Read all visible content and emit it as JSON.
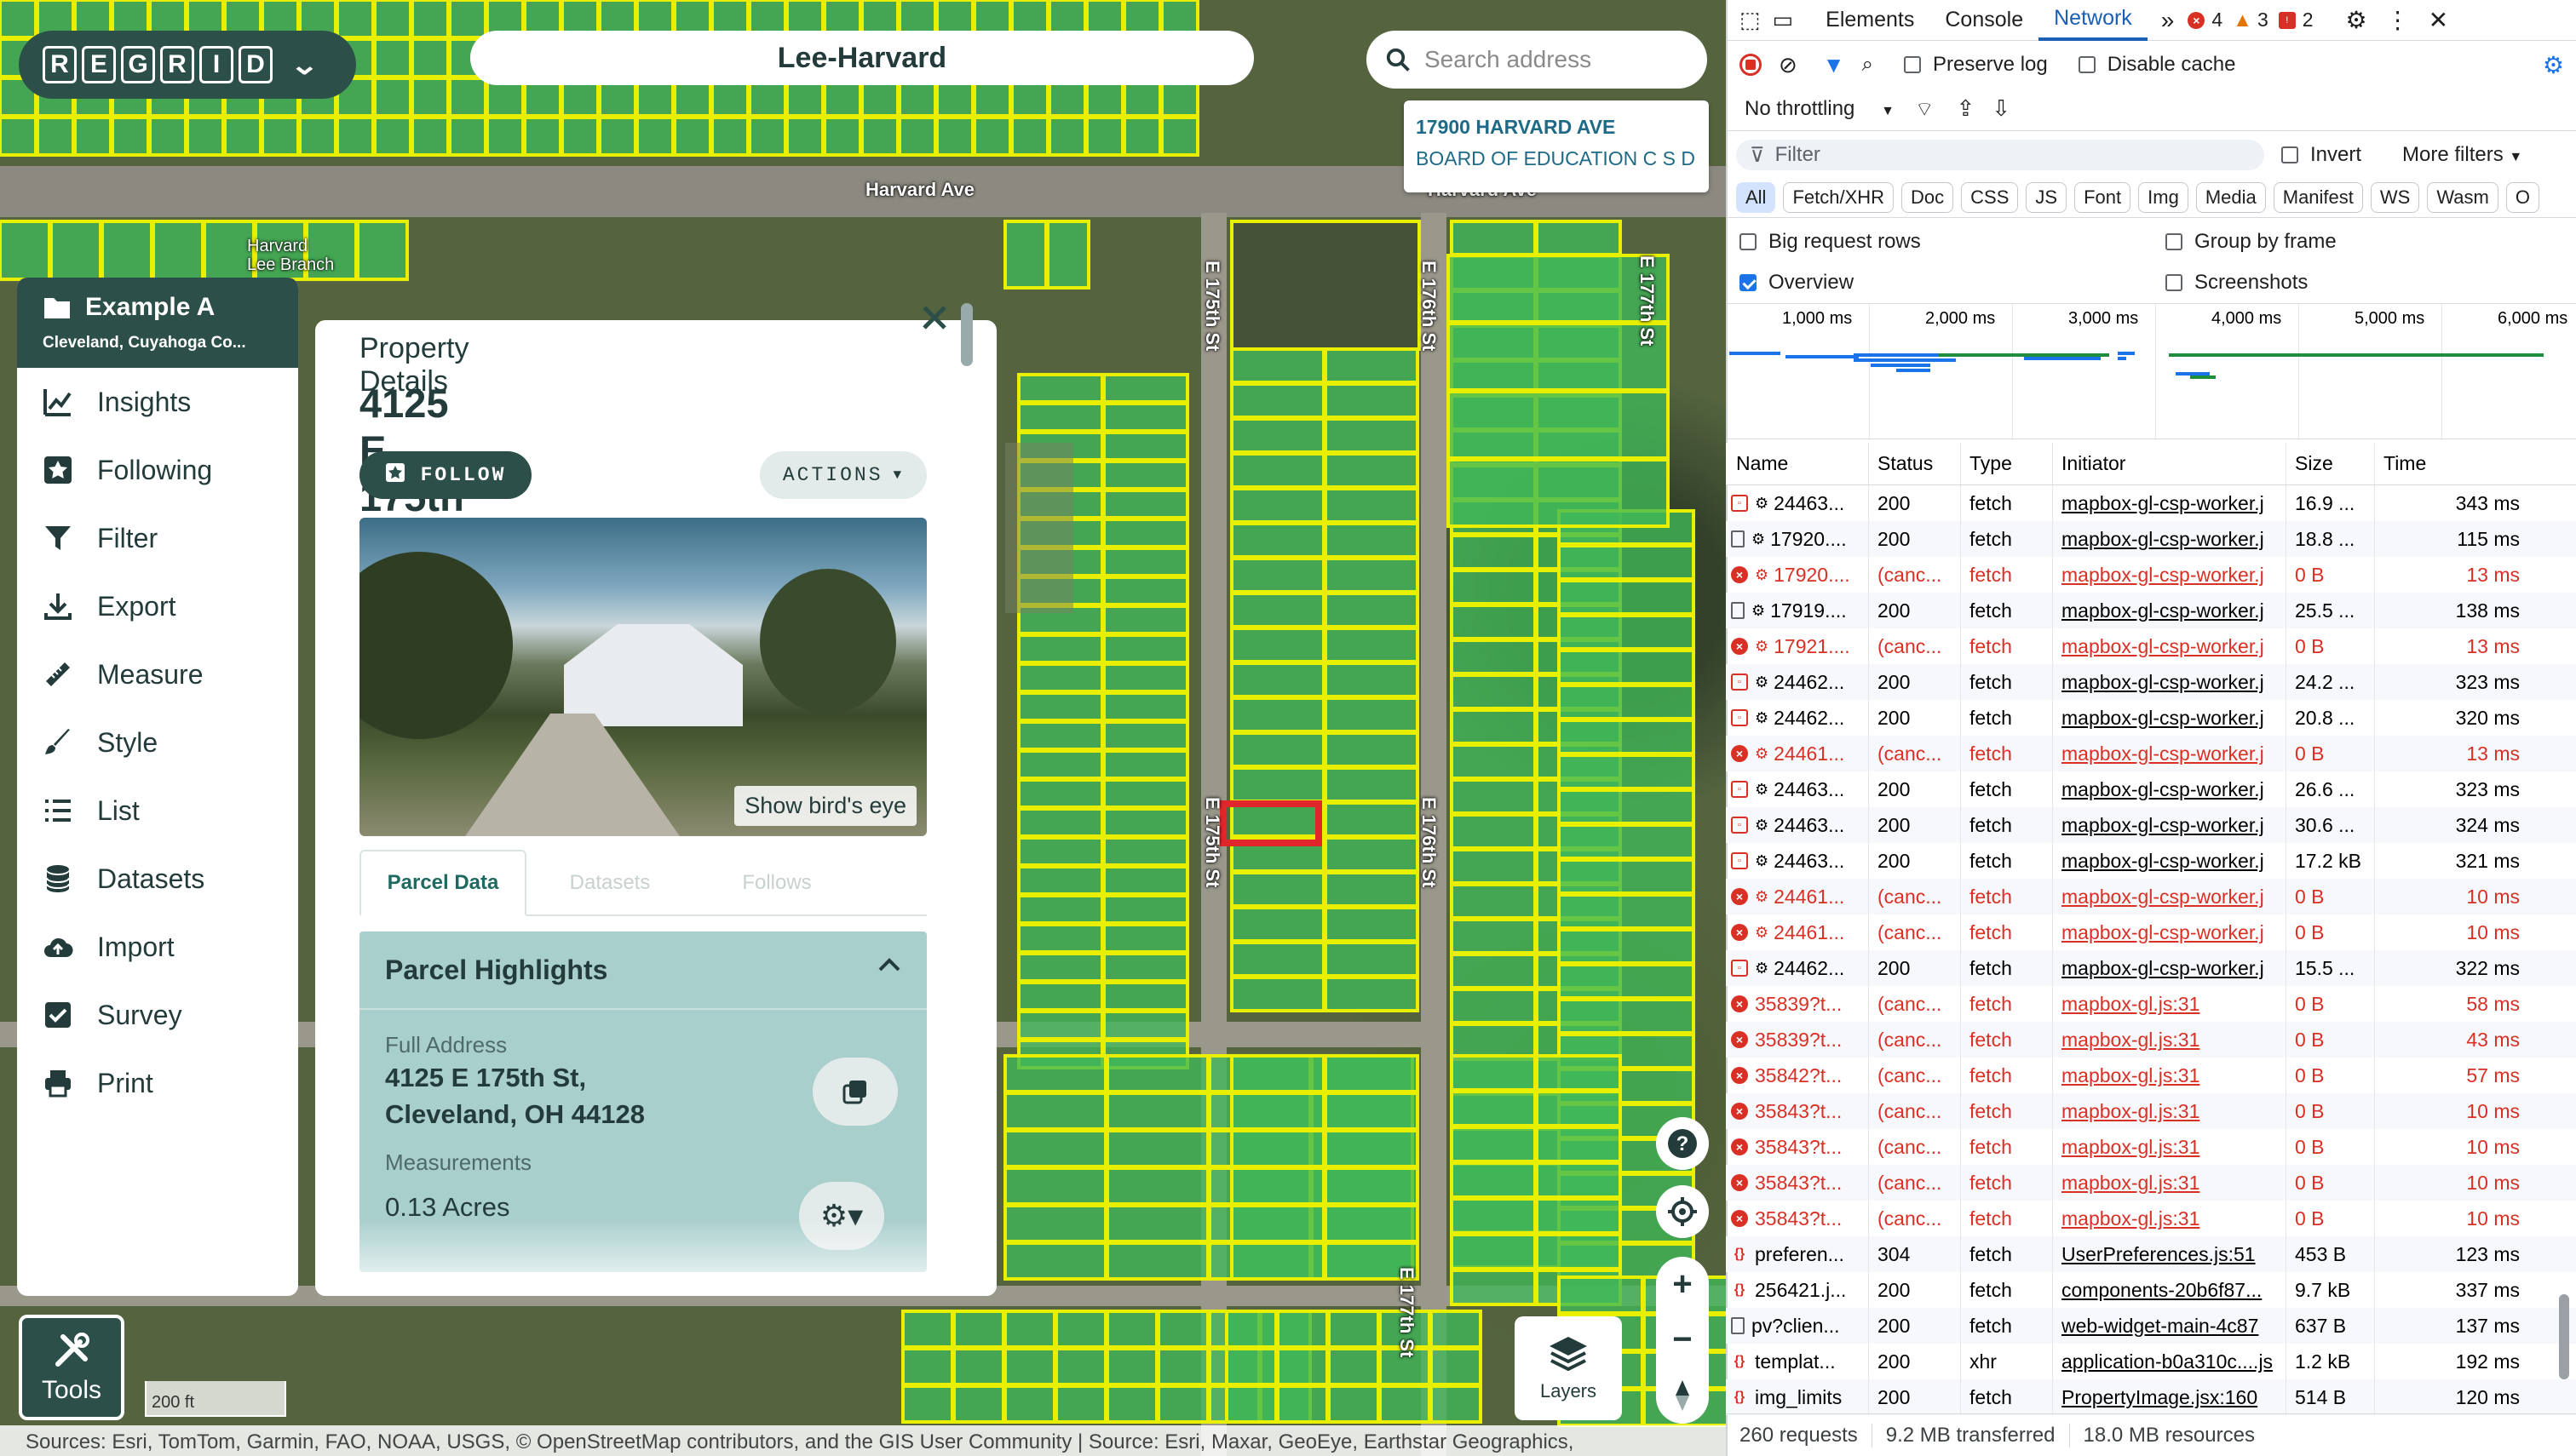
{
  "map": {
    "title": "Lee-Harvard",
    "search_placeholder": "Search address",
    "hover_card": {
      "address": "17900 HARVARD AVE",
      "owner": "BOARD OF EDUCATION C S D"
    },
    "road_labels": [
      "Harvard Ave",
      "Harvard Ave",
      "Harvard\nLee Branch",
      "E 175th St",
      "E 176th St",
      "E 177th St",
      "E 175th St",
      "E 176th St",
      "E 177th St"
    ],
    "scale": "200 ft",
    "attribution": "Sources: Esri, TomTom, Garmin, FAO, NOAA, USGS, © OpenStreetMap contributors, and the GIS User Community | Source: Esri, Maxar, GeoEye, Earthstar Geographics,",
    "layers_label": "Layers",
    "tools_label": "Tools",
    "parcel_color": "#e8f000",
    "selected_color": "#e0262a"
  },
  "logo": {
    "letters": [
      "R",
      "E",
      "G",
      "R",
      "I",
      "D"
    ]
  },
  "sidebar": {
    "project_name": "Example A",
    "project_location": "Cleveland, Cuyahoga Co...",
    "items": [
      {
        "label": "Insights",
        "icon": "chart-icon"
      },
      {
        "label": "Following",
        "icon": "star-icon"
      },
      {
        "label": "Filter",
        "icon": "funnel-icon"
      },
      {
        "label": "Export",
        "icon": "download-icon"
      },
      {
        "label": "Measure",
        "icon": "ruler-icon"
      },
      {
        "label": "Style",
        "icon": "brush-icon"
      },
      {
        "label": "List",
        "icon": "list-icon"
      },
      {
        "label": "Datasets",
        "icon": "database-icon"
      },
      {
        "label": "Import",
        "icon": "cloud-upload-icon"
      },
      {
        "label": "Survey",
        "icon": "checkbox-icon"
      },
      {
        "label": "Print",
        "icon": "printer-icon"
      }
    ]
  },
  "property": {
    "heading": "Property Details",
    "address": "4125 E 175th St",
    "follow_label": "FOLLOW",
    "actions_label": "ACTIONS",
    "birds_eye_label": "Show bird's eye",
    "tabs": [
      "Parcel Data",
      "Datasets",
      "Follows"
    ],
    "highlights_title": "Parcel Highlights",
    "full_address_label": "Full Address",
    "full_address_line1": "4125 E 175th St,",
    "full_address_line2": "Cleveland, OH 44128",
    "measurements_label": "Measurements",
    "measurements_value": "0.13 Acres"
  },
  "devtools": {
    "tabs": [
      "Elements",
      "Console",
      "Network"
    ],
    "active_tab": "Network",
    "errors": "4",
    "warnings": "3",
    "issues": "2",
    "preserve_log": "Preserve log",
    "disable_cache": "Disable cache",
    "throttling": "No throttling",
    "filter_placeholder": "Filter",
    "invert": "Invert",
    "more_filters": "More filters",
    "chips": [
      "All",
      "Fetch/XHR",
      "Doc",
      "CSS",
      "JS",
      "Font",
      "Img",
      "Media",
      "Manifest",
      "WS",
      "Wasm",
      "O"
    ],
    "options": [
      "Big request rows",
      "Group by frame",
      "Overview",
      "Screenshots"
    ],
    "overview_ticks": [
      "1,000 ms",
      "2,000 ms",
      "3,000 ms",
      "4,000 ms",
      "5,000 ms",
      "6,000 ms"
    ],
    "columns": [
      "Name",
      "Status",
      "Type",
      "Initiator",
      "Size",
      "Time"
    ],
    "rows": [
      {
        "icon": "fx",
        "name": "24463...",
        "status": "200",
        "type": "fetch",
        "initiator": "mapbox-gl-csp-worker.j",
        "size": "16.9 ...",
        "time": "343 ms",
        "err": false,
        "gear": true
      },
      {
        "icon": "doc",
        "name": "17920....",
        "status": "200",
        "type": "fetch",
        "initiator": "mapbox-gl-csp-worker.j",
        "size": "18.8 ...",
        "time": "115 ms",
        "err": false,
        "gear": true
      },
      {
        "icon": "err",
        "name": "17920....",
        "status": "(canc...",
        "type": "fetch",
        "initiator": "mapbox-gl-csp-worker.j",
        "size": "0 B",
        "time": "13 ms",
        "err": true,
        "gear": true
      },
      {
        "icon": "doc",
        "name": "17919....",
        "status": "200",
        "type": "fetch",
        "initiator": "mapbox-gl-csp-worker.j",
        "size": "25.5 ...",
        "time": "138 ms",
        "err": false,
        "gear": true
      },
      {
        "icon": "err",
        "name": "17921....",
        "status": "(canc...",
        "type": "fetch",
        "initiator": "mapbox-gl-csp-worker.j",
        "size": "0 B",
        "time": "13 ms",
        "err": true,
        "gear": true
      },
      {
        "icon": "fx",
        "name": "24462...",
        "status": "200",
        "type": "fetch",
        "initiator": "mapbox-gl-csp-worker.j",
        "size": "24.2 ...",
        "time": "323 ms",
        "err": false,
        "gear": true
      },
      {
        "icon": "fx",
        "name": "24462...",
        "status": "200",
        "type": "fetch",
        "initiator": "mapbox-gl-csp-worker.j",
        "size": "20.8 ...",
        "time": "320 ms",
        "err": false,
        "gear": true
      },
      {
        "icon": "err",
        "name": "24461...",
        "status": "(canc...",
        "type": "fetch",
        "initiator": "mapbox-gl-csp-worker.j",
        "size": "0 B",
        "time": "13 ms",
        "err": true,
        "gear": true
      },
      {
        "icon": "fx",
        "name": "24463...",
        "status": "200",
        "type": "fetch",
        "initiator": "mapbox-gl-csp-worker.j",
        "size": "26.6 ...",
        "time": "323 ms",
        "err": false,
        "gear": true
      },
      {
        "icon": "fx",
        "name": "24463...",
        "status": "200",
        "type": "fetch",
        "initiator": "mapbox-gl-csp-worker.j",
        "size": "30.6 ...",
        "time": "324 ms",
        "err": false,
        "gear": true
      },
      {
        "icon": "fx",
        "name": "24463...",
        "status": "200",
        "type": "fetch",
        "initiator": "mapbox-gl-csp-worker.j",
        "size": "17.2 kB",
        "time": "321 ms",
        "err": false,
        "gear": true
      },
      {
        "icon": "err",
        "name": "24461...",
        "status": "(canc...",
        "type": "fetch",
        "initiator": "mapbox-gl-csp-worker.j",
        "size": "0 B",
        "time": "10 ms",
        "err": true,
        "gear": true
      },
      {
        "icon": "err",
        "name": "24461...",
        "status": "(canc...",
        "type": "fetch",
        "initiator": "mapbox-gl-csp-worker.j",
        "size": "0 B",
        "time": "10 ms",
        "err": true,
        "gear": true
      },
      {
        "icon": "fx",
        "name": "24462...",
        "status": "200",
        "type": "fetch",
        "initiator": "mapbox-gl-csp-worker.j",
        "size": "15.5 ...",
        "time": "322 ms",
        "err": false,
        "gear": true
      },
      {
        "icon": "err",
        "name": "35839?t...",
        "status": "(canc...",
        "type": "fetch",
        "initiator": "mapbox-gl.js:31",
        "size": "0 B",
        "time": "58 ms",
        "err": true,
        "gear": false
      },
      {
        "icon": "err",
        "name": "35839?t...",
        "status": "(canc...",
        "type": "fetch",
        "initiator": "mapbox-gl.js:31",
        "size": "0 B",
        "time": "43 ms",
        "err": true,
        "gear": false
      },
      {
        "icon": "err",
        "name": "35842?t...",
        "status": "(canc...",
        "type": "fetch",
        "initiator": "mapbox-gl.js:31",
        "size": "0 B",
        "time": "57 ms",
        "err": true,
        "gear": false
      },
      {
        "icon": "err",
        "name": "35843?t...",
        "status": "(canc...",
        "type": "fetch",
        "initiator": "mapbox-gl.js:31",
        "size": "0 B",
        "time": "10 ms",
        "err": true,
        "gear": false
      },
      {
        "icon": "err",
        "name": "35843?t...",
        "status": "(canc...",
        "type": "fetch",
        "initiator": "mapbox-gl.js:31",
        "size": "0 B",
        "time": "10 ms",
        "err": true,
        "gear": false
      },
      {
        "icon": "err",
        "name": "35843?t...",
        "status": "(canc...",
        "type": "fetch",
        "initiator": "mapbox-gl.js:31",
        "size": "0 B",
        "time": "10 ms",
        "err": true,
        "gear": false
      },
      {
        "icon": "err",
        "name": "35843?t...",
        "status": "(canc...",
        "type": "fetch",
        "initiator": "mapbox-gl.js:31",
        "size": "0 B",
        "time": "10 ms",
        "err": true,
        "gear": false
      },
      {
        "icon": "js",
        "name": "preferen...",
        "status": "304",
        "type": "fetch",
        "initiator": "UserPreferences.js:51",
        "size": "453 B",
        "time": "123 ms",
        "err": false,
        "gear": false
      },
      {
        "icon": "js",
        "name": "256421.j...",
        "status": "200",
        "type": "fetch",
        "initiator": "components-20b6f87...",
        "size": "9.7 kB",
        "time": "337 ms",
        "err": false,
        "gear": false
      },
      {
        "icon": "doc",
        "name": "pv?clien...",
        "status": "200",
        "type": "fetch",
        "initiator": "web-widget-main-4c87",
        "size": "637 B",
        "time": "137 ms",
        "err": false,
        "gear": false
      },
      {
        "icon": "js",
        "name": "templat...",
        "status": "200",
        "type": "xhr",
        "initiator": "application-b0a310c....js",
        "size": "1.2 kB",
        "time": "192 ms",
        "err": false,
        "gear": false
      },
      {
        "icon": "js",
        "name": "img_limits",
        "status": "200",
        "type": "fetch",
        "initiator": "PropertyImage.jsx:160",
        "size": "514 B",
        "time": "120 ms",
        "err": false,
        "gear": false
      }
    ],
    "status_bar": [
      "260 requests",
      "9.2 MB transferred",
      "18.0 MB resources"
    ]
  }
}
